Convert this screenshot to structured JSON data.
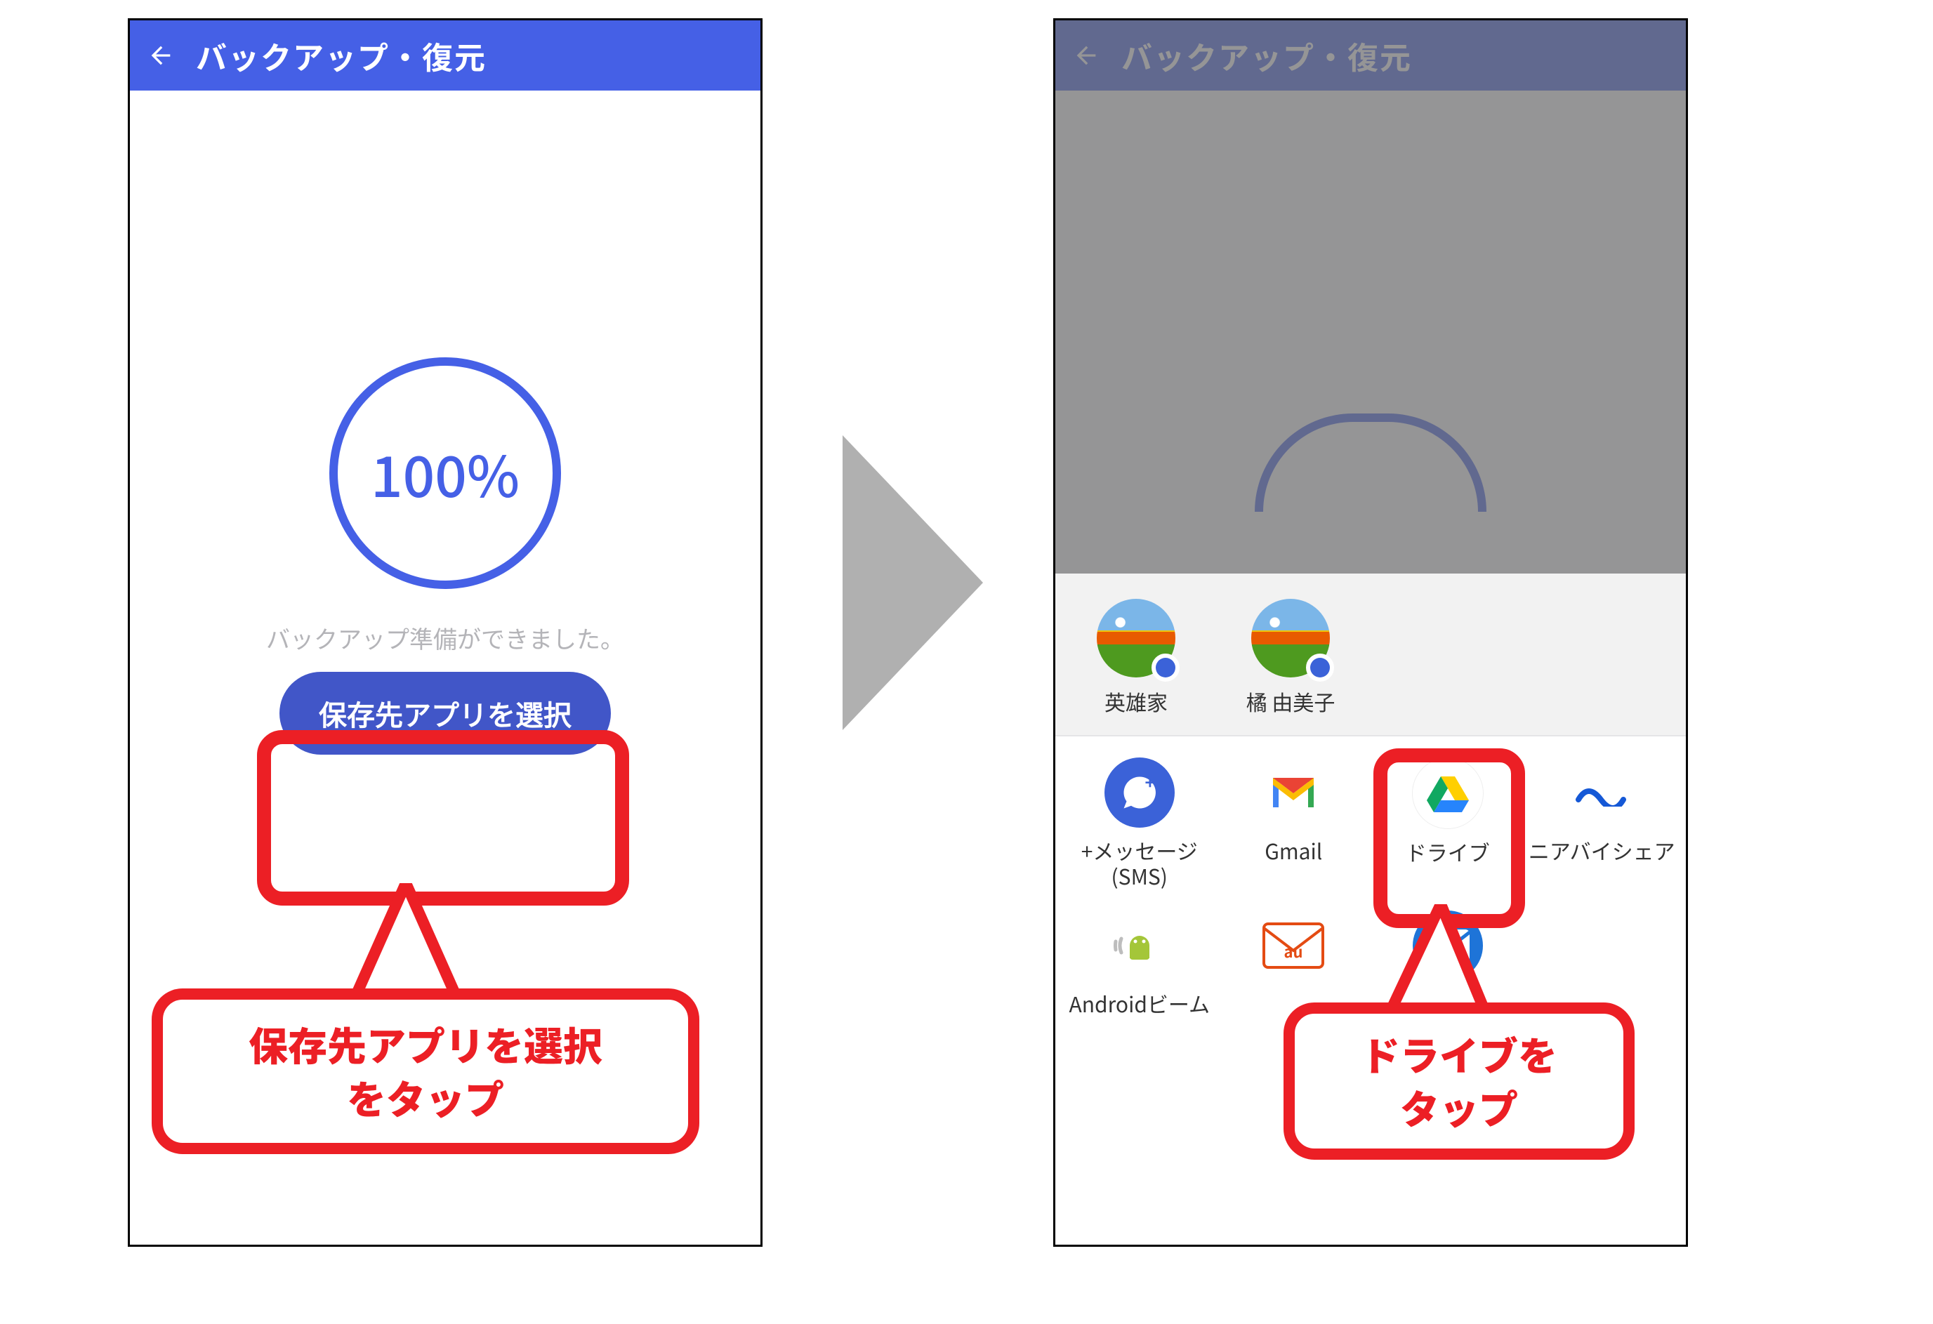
{
  "appbar": {
    "title": "バックアップ・復元"
  },
  "left": {
    "progress": "100%",
    "prep_text": "バックアップ準備ができました。",
    "select_button": "保存先アプリを選択"
  },
  "right": {
    "contacts": [
      {
        "name": "英雄家"
      },
      {
        "name": "橘 由美子"
      }
    ],
    "apps": [
      {
        "name": "+メッセージ(SMS)",
        "icon": "plus-message"
      },
      {
        "name": "Gmail",
        "icon": "gmail"
      },
      {
        "name": "ドライブ",
        "icon": "drive"
      },
      {
        "name": "ニアバイシェア",
        "icon": "nearby"
      },
      {
        "name": "Androidビーム",
        "icon": "android-beam"
      },
      {
        "name": "",
        "icon": "au-mail"
      },
      {
        "name": "",
        "icon": "mail-blue"
      }
    ]
  },
  "callouts": {
    "left": "保存先アプリを選択\nをタップ",
    "right": "ドライブを\nタップ"
  }
}
